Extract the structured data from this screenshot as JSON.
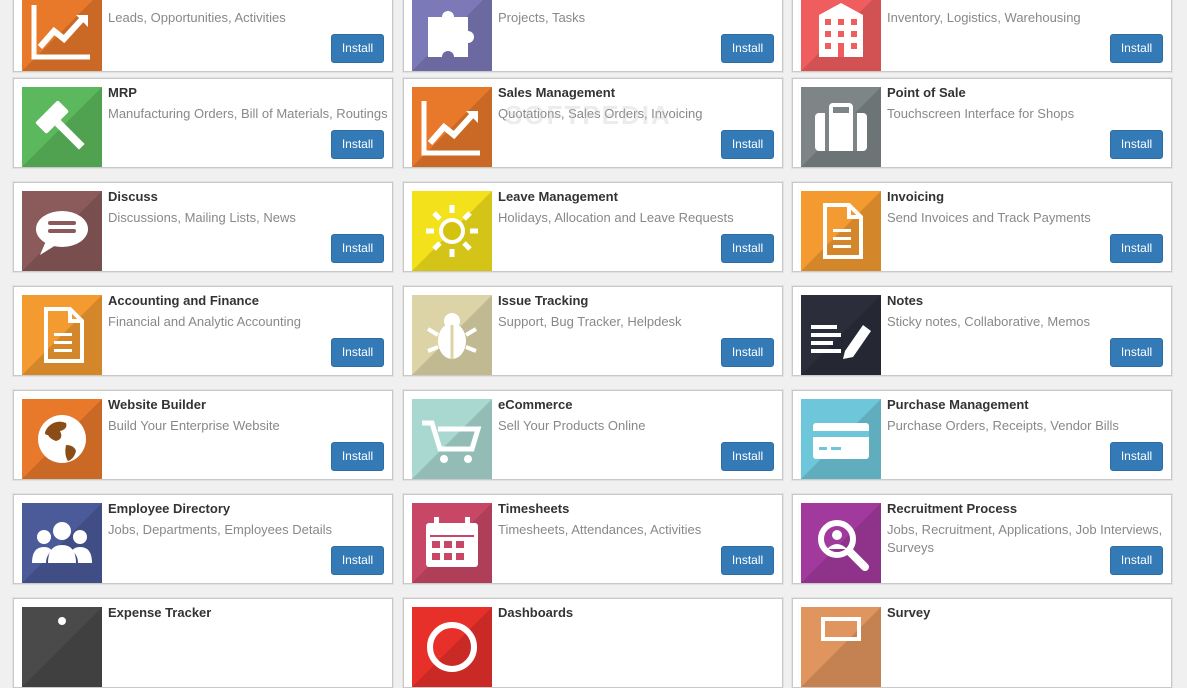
{
  "install_label": "Install",
  "watermark": "SOFTPEDIA",
  "cards": [
    {
      "title": "",
      "desc": "Leads, Opportunities, Activities",
      "color": "#e8792b",
      "icon": "chart-icon"
    },
    {
      "title": "",
      "desc": "Projects, Tasks",
      "color": "#7b79b7",
      "icon": "puzzle-icon"
    },
    {
      "title": "",
      "desc": "Inventory, Logistics, Warehousing",
      "color": "#f05d5e",
      "icon": "building-icon"
    },
    {
      "title": "MRP",
      "desc": "Manufacturing Orders, Bill of Materials, Routings",
      "color": "#5cb85c",
      "icon": "hammer-icon"
    },
    {
      "title": "Sales Management",
      "desc": "Quotations, Sales Orders, Invoicing",
      "color": "#e8792b",
      "icon": "chart-icon"
    },
    {
      "title": "Point of Sale",
      "desc": "Touchscreen Interface for Shops",
      "color": "#7d8587",
      "icon": "briefcase-icon"
    },
    {
      "title": "Discuss",
      "desc": "Discussions, Mailing Lists, News",
      "color": "#8b5a5a",
      "icon": "chat-icon"
    },
    {
      "title": "Leave Management",
      "desc": "Holidays, Allocation and Leave Requests",
      "color": "#f2e11b",
      "icon": "sun-icon"
    },
    {
      "title": "Invoicing",
      "desc": "Send Invoices and Track Payments",
      "color": "#f39a31",
      "icon": "document-icon"
    },
    {
      "title": "Accounting and Finance",
      "desc": "Financial and Analytic Accounting",
      "color": "#f39a31",
      "icon": "document-icon"
    },
    {
      "title": "Issue Tracking",
      "desc": "Support, Bug Tracker, Helpdesk",
      "color": "#dcd3a6",
      "icon": "bug-icon"
    },
    {
      "title": "Notes",
      "desc": "Sticky notes, Collaborative, Memos",
      "color": "#2b2e3a",
      "icon": "note-icon"
    },
    {
      "title": "Website Builder",
      "desc": "Build Your Enterprise Website",
      "color": "#e8792b",
      "icon": "globe-icon"
    },
    {
      "title": "eCommerce",
      "desc": "Sell Your Products Online",
      "color": "#a8d8d0",
      "icon": "cart-icon"
    },
    {
      "title": "Purchase Management",
      "desc": "Purchase Orders, Receipts, Vendor Bills",
      "color": "#6dc6d9",
      "icon": "card-icon"
    },
    {
      "title": "Employee Directory",
      "desc": "Jobs, Departments, Employees Details",
      "color": "#4b5a99",
      "icon": "people-icon"
    },
    {
      "title": "Timesheets",
      "desc": "Timesheets, Attendances, Activities",
      "color": "#c94766",
      "icon": "calendar-icon"
    },
    {
      "title": "Recruitment Process",
      "desc": "Jobs, Recruitment, Applications, Job Interviews, Surveys",
      "color": "#a23a9e",
      "icon": "magnifier-icon"
    },
    {
      "title": "Expense Tracker",
      "desc": "",
      "color": "#4a4a4a",
      "icon": "expense-icon"
    },
    {
      "title": "Dashboards",
      "desc": "",
      "color": "#e8302b",
      "icon": "dashboard-icon"
    },
    {
      "title": "Survey",
      "desc": "",
      "color": "#e0955e",
      "icon": "survey-icon"
    }
  ]
}
